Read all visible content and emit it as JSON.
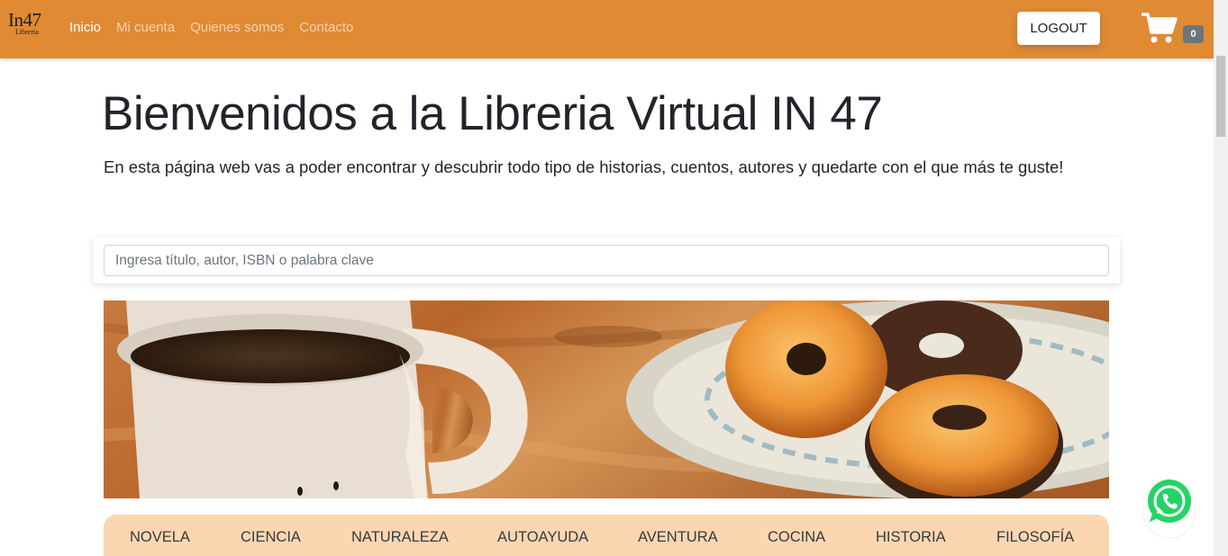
{
  "brand": {
    "main": "In47",
    "sub": "Libreria"
  },
  "nav": {
    "links": [
      {
        "label": "Inicio",
        "active": true
      },
      {
        "label": "Mi cuenta",
        "active": false
      },
      {
        "label": "Quienes somos",
        "active": false
      },
      {
        "label": "Contacto",
        "active": false
      }
    ],
    "logout_label": "LOGOUT",
    "cart_count": "0",
    "cart_icon": "shopping-cart-icon"
  },
  "hero": {
    "title": "Bienvenidos a la Libreria Virtual IN 47",
    "subtitle": "En esta página web vas a poder encontrar y descubrir todo tipo de historias, cuentos, autores y quedarte con el que más te guste!"
  },
  "search": {
    "placeholder": "Ingresa título, autor, ISBN o palabra clave",
    "value": ""
  },
  "categories": [
    "NOVELA",
    "CIENCIA",
    "NATURALEZA",
    "AUTOAYUDA",
    "AVENTURA",
    "COCINA",
    "HISTORIA",
    "FILOSOFÍA"
  ],
  "floating": {
    "whatsapp_icon": "whatsapp-icon"
  },
  "colors": {
    "navbar": "#e08a33",
    "category_bar": "#fcd6b0",
    "whatsapp": "#25d366"
  }
}
